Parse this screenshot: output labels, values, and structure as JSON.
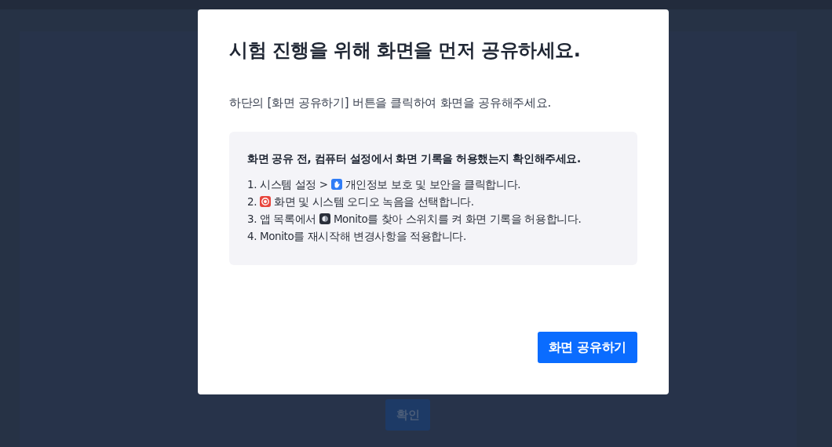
{
  "background": {
    "confirm_button": "확인"
  },
  "dialog": {
    "title": "시험 진행을 위해 화면을 먼저 공유하세요.",
    "subtitle": "하단의 [화면 공유하기] 버튼을 클릭하여 화면을 공유해주세요.",
    "notice": {
      "heading": "화면 공유 전, 컴퓨터 설정에서 화면 기록을 허용했는지 확인해주세요.",
      "steps": [
        {
          "kind": "privacy",
          "before": "1. 시스템 설정 >",
          "after": "개인정보 보호 및 보안을 클릭합니다."
        },
        {
          "kind": "recording",
          "before": "2.",
          "after": "화면 및 시스템 오디오 녹음을 선택합니다."
        },
        {
          "kind": "app",
          "before": "3. 앱 목록에서",
          "after": "Monito를 찾아 스위치를 켜 화면 기록을 허용합니다."
        },
        {
          "kind": "plain",
          "before": "4. Monito를 재시작해 변경사항을 적용합니다."
        }
      ]
    },
    "share_button": "화면 공유하기"
  }
}
